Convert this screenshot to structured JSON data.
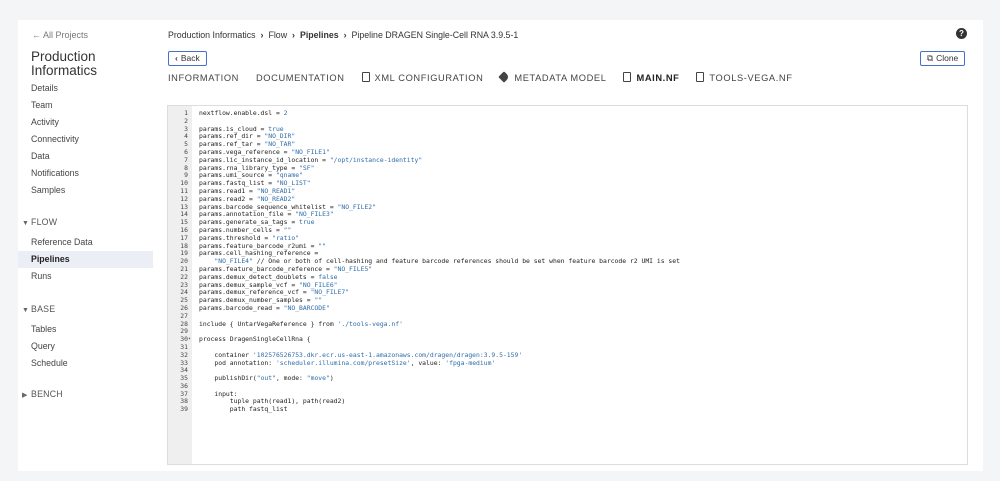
{
  "sidebar": {
    "back_link": "← All Projects",
    "project_title": "Production Informatics",
    "items": [
      "Details",
      "Team",
      "Activity",
      "Connectivity",
      "Data",
      "Notifications",
      "Samples"
    ],
    "flow": {
      "label": "FLOW",
      "items": [
        "Reference Data",
        "Pipelines",
        "Runs"
      ],
      "active": "Pipelines"
    },
    "base": {
      "label": "BASE",
      "items": [
        "Tables",
        "Query",
        "Schedule"
      ]
    },
    "bench": {
      "label": "BENCH"
    }
  },
  "breadcrumb": {
    "items": [
      "Production Informatics",
      "Flow",
      "Pipelines",
      "Pipeline DRAGEN Single-Cell RNA 3.9.5-1"
    ]
  },
  "toolbar": {
    "back_label": "Back",
    "clone_label": "Clone",
    "help_label": "?"
  },
  "tabs": [
    {
      "label": "INFORMATION",
      "icon": ""
    },
    {
      "label": "DOCUMENTATION",
      "icon": ""
    },
    {
      "label": "XML CONFIGURATION",
      "icon": "document-icon"
    },
    {
      "label": "METADATA MODEL",
      "icon": "tag-icon"
    },
    {
      "label": "MAIN.NF",
      "icon": "document-icon",
      "active": true
    },
    {
      "label": "TOOLS-VEGA.NF",
      "icon": "document-icon"
    }
  ],
  "code": [
    "nextflow.enable.dsl = 2",
    "",
    "params.is_cloud = true",
    "params.ref_dir = \"NO_DIR\"",
    "params.ref_tar = \"NO_TAR\"",
    "params.vega_reference = \"NO_FILE1\"",
    "params.lic_instance_id_location = \"/opt/instance-identity\"",
    "params.rna_library_type = \"SF\"",
    "params.umi_source = \"qname\"",
    "params.fastq_list = \"NO_LIST\"",
    "params.read1 = \"NO_READ1\"",
    "params.read2 = \"NO_READ2\"",
    "params.barcode_sequence_whitelist = \"NO_FILE2\"",
    "params.annotation_file = \"NO_FILE3\"",
    "params.generate_sa_tags = true",
    "params.number_cells = \"\"",
    "params.threshold = \"ratio\"",
    "params.feature_barcode_r2umi = \"\"",
    "params.cell_hashing_reference =",
    "    \"NO_FILE4\" // One or both of cell-hashing and feature barcode references should be set when feature barcode r2 UMI is set",
    "params.feature_barcode_reference = \"NO_FILE5\"",
    "params.demux_detect_doublets = false",
    "params.demux_sample_vcf = \"NO_FILE6\"",
    "params.demux_reference_vcf = \"NO_FILE7\"",
    "params.demux_number_samples = \"\"",
    "params.barcode_read = \"NO_BARCODE\"",
    "",
    "include { UntarVegaReference } from './tools-vega.nf'",
    "",
    "process DragenSingleCellRna {",
    "",
    "    container '102576526753.dkr.ecr.us-east-1.amazonaws.com/dragen/dragen:3.9.5-159'",
    "    pod annotation: 'scheduler.illumina.com/presetSize', value: 'fpga-medium'",
    "",
    "    publishDir(\"out\", mode: \"move\")",
    "",
    "    input:",
    "        tuple path(read1), path(read2)",
    "        path fastq_list"
  ],
  "fold_line": 30
}
